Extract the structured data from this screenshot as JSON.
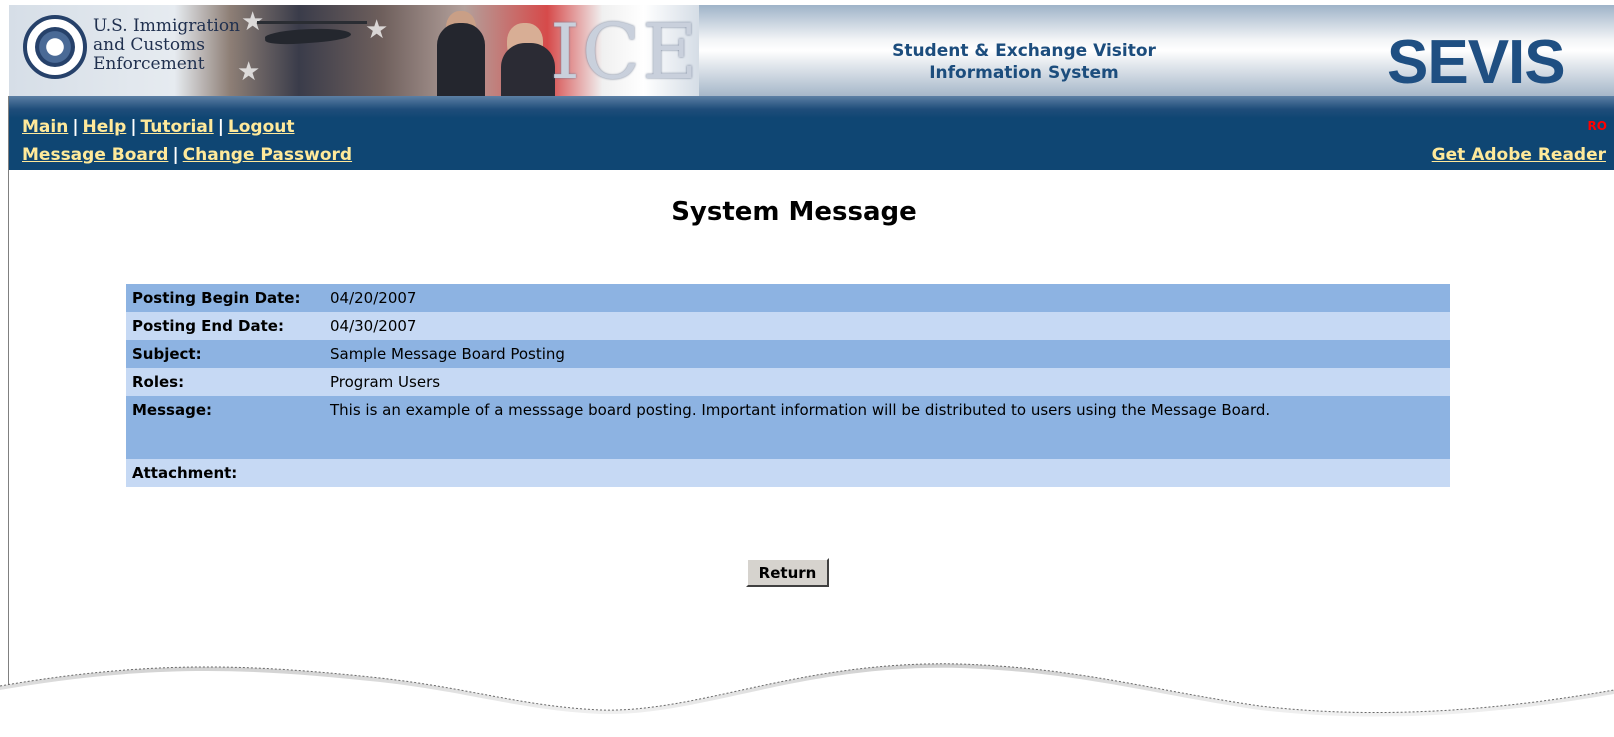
{
  "banner": {
    "agency_lines": [
      "U.S. Immigration",
      "and Customs",
      "Enforcement"
    ],
    "ice_logo": "ICE",
    "system_name_lines": [
      "Student & Exchange Visitor",
      "Information System"
    ],
    "sevis_logo": "SEVIS"
  },
  "nav": {
    "row1": [
      {
        "label": "Main"
      },
      {
        "label": "Help"
      },
      {
        "label": "Tutorial"
      },
      {
        "label": "Logout"
      }
    ],
    "row2": [
      {
        "label": "Message Board"
      },
      {
        "label": "Change Password"
      }
    ],
    "ro_badge": "RO",
    "adobe_link": "Get Adobe Reader"
  },
  "page": {
    "title": "System Message",
    "fields": [
      {
        "label": "Posting Begin Date:",
        "value": "04/20/2007"
      },
      {
        "label": "Posting End Date:",
        "value": "04/30/2007"
      },
      {
        "label": "Subject:",
        "value": "Sample Message Board Posting"
      },
      {
        "label": "Roles:",
        "value": "Program Users"
      },
      {
        "label": "Message:",
        "value": "This is an example of a messsage board posting. Important information will be distributed to users using the Message Board."
      },
      {
        "label": "Attachment:",
        "value": ""
      }
    ],
    "return_label": "Return"
  },
  "colors": {
    "nav_bar": "#0f4673",
    "nav_link": "#ffe99a",
    "row_dark": "#8db3e2",
    "row_light": "#c6d9f4",
    "ro_badge": "#ff0000",
    "sevis_logo": "#1f4f82"
  }
}
